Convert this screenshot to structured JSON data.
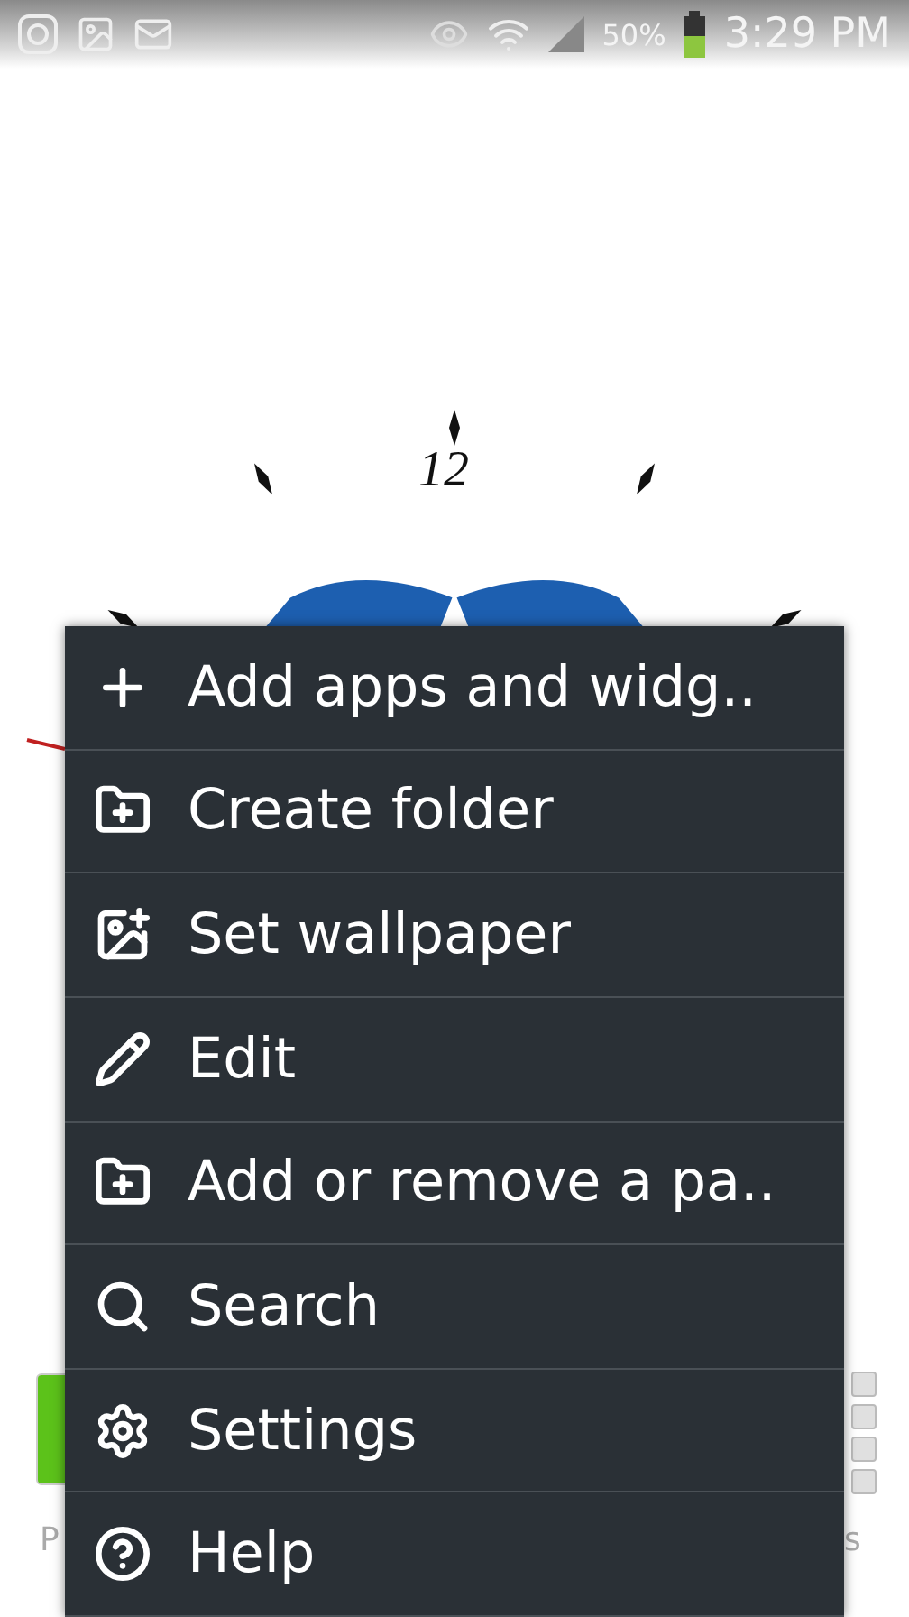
{
  "status_bar": {
    "battery_percent": "50%",
    "time": "3:29 PM"
  },
  "home_screen": {
    "clock": {
      "numeral": "12"
    },
    "labels": [
      "P",
      "s"
    ]
  },
  "menu": {
    "items": [
      {
        "kind": "add",
        "label": "Add apps and widg.."
      },
      {
        "kind": "folder",
        "label": "Create folder"
      },
      {
        "kind": "wallpaper",
        "label": "Set wallpaper"
      },
      {
        "kind": "edit",
        "label": "Edit"
      },
      {
        "kind": "page",
        "label": "Add or remove a pa.."
      },
      {
        "kind": "search",
        "label": "Search"
      },
      {
        "kind": "settings",
        "label": "Settings"
      },
      {
        "kind": "help",
        "label": "Help"
      }
    ]
  }
}
